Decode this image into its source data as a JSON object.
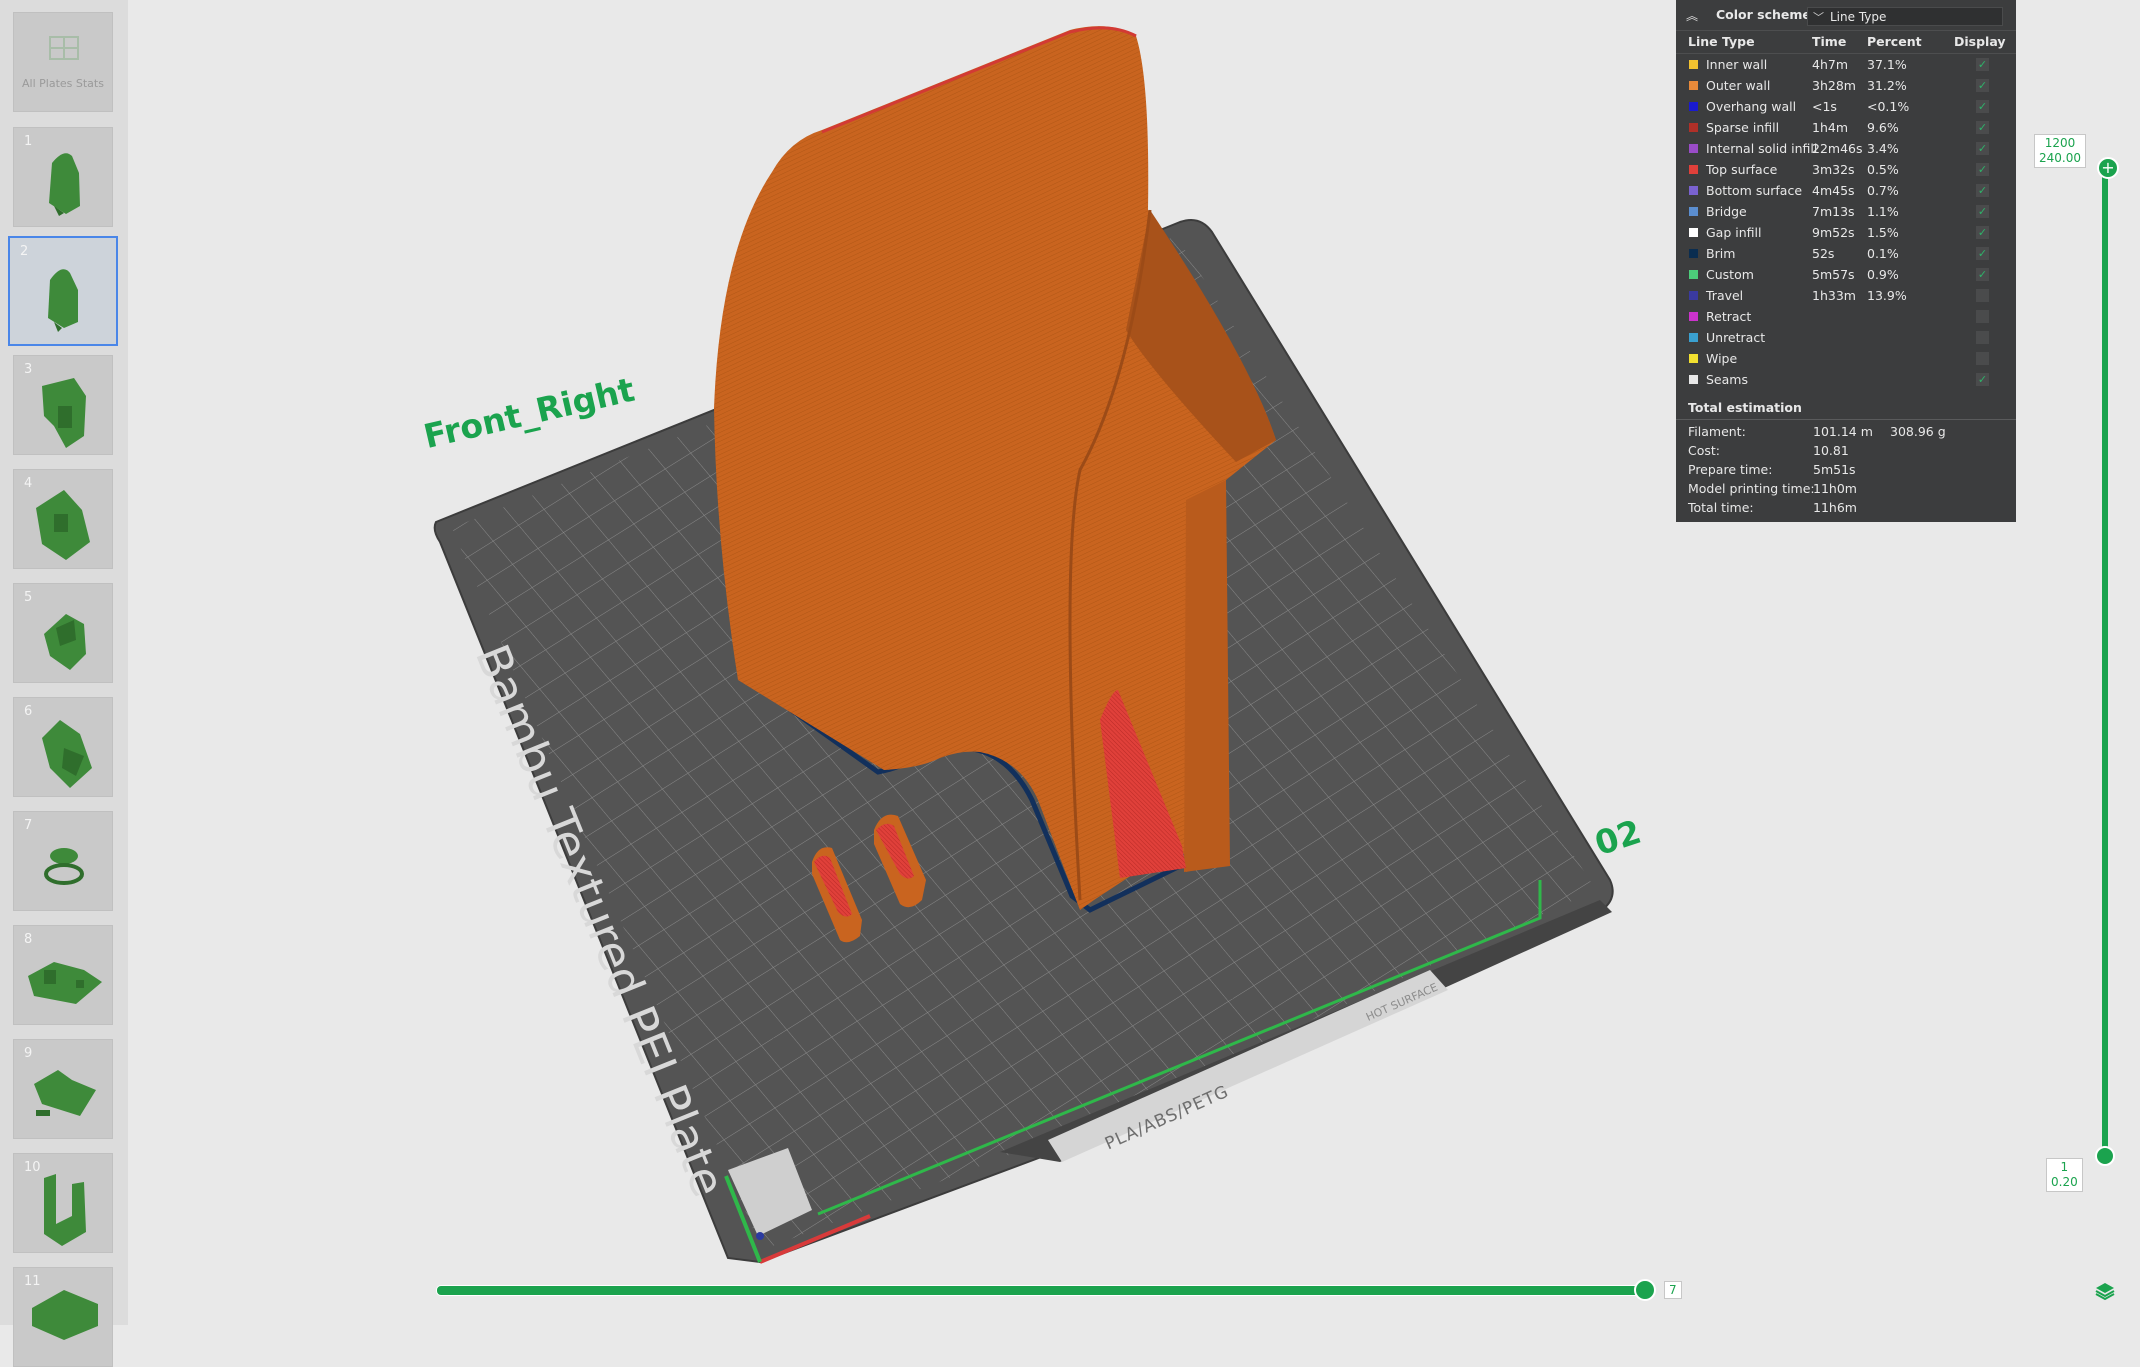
{
  "plates": {
    "all_label": "All Plates Stats",
    "items": [
      {
        "num": "1"
      },
      {
        "num": "2"
      },
      {
        "num": "3"
      },
      {
        "num": "4"
      },
      {
        "num": "5"
      },
      {
        "num": "6"
      },
      {
        "num": "7"
      },
      {
        "num": "8"
      },
      {
        "num": "9"
      },
      {
        "num": "10"
      },
      {
        "num": "11"
      }
    ],
    "selected": "2"
  },
  "scene": {
    "view_label": "Front_Right",
    "plate_name": "Bambu Textured PEI Plate",
    "plate_number": "02",
    "plate_material": "PLA/ABS/PETG",
    "hot_surface": "HOT SURFACE"
  },
  "legend": {
    "title": "Color scheme",
    "scheme": "Line Type",
    "headers": {
      "type": "Line Type",
      "time": "Time",
      "percent": "Percent",
      "display": "Display"
    },
    "rows": [
      {
        "label": "Inner wall",
        "time": "4h7m",
        "percent": "37.1%",
        "color": "#f2c230",
        "checked": true
      },
      {
        "label": "Outer wall",
        "time": "3h28m",
        "percent": "31.2%",
        "color": "#e88a3a",
        "checked": true
      },
      {
        "label": "Overhang wall",
        "time": "<1s",
        "percent": "<0.1%",
        "color": "#1a1ad0",
        "checked": true
      },
      {
        "label": "Sparse infill",
        "time": "1h4m",
        "percent": "9.6%",
        "color": "#b03028",
        "checked": true
      },
      {
        "label": "Internal solid infill",
        "time": "22m46s",
        "percent": "3.4%",
        "color": "#9a4cc8",
        "checked": true
      },
      {
        "label": "Top surface",
        "time": "3m32s",
        "percent": "0.5%",
        "color": "#e0403a",
        "checked": true
      },
      {
        "label": "Bottom surface",
        "time": "4m45s",
        "percent": "0.7%",
        "color": "#7a62d0",
        "checked": true
      },
      {
        "label": "Bridge",
        "time": "7m13s",
        "percent": "1.1%",
        "color": "#5b8ed0",
        "checked": true
      },
      {
        "label": "Gap infill",
        "time": "9m52s",
        "percent": "1.5%",
        "color": "#ffffff",
        "checked": true
      },
      {
        "label": "Brim",
        "time": "52s",
        "percent": "0.1%",
        "color": "#0a2d50",
        "checked": true
      },
      {
        "label": "Custom",
        "time": "5m57s",
        "percent": "0.9%",
        "color": "#4ccc7a",
        "checked": true
      },
      {
        "label": "Travel",
        "time": "1h33m",
        "percent": "13.9%",
        "color": "#3a3aa0",
        "checked": false
      },
      {
        "label": "Retract",
        "time": "",
        "percent": "",
        "color": "#cc33cc",
        "checked": false
      },
      {
        "label": "Unretract",
        "time": "",
        "percent": "",
        "color": "#3aa0d0",
        "checked": false
      },
      {
        "label": "Wipe",
        "time": "",
        "percent": "",
        "color": "#f2e030",
        "checked": false
      },
      {
        "label": "Seams",
        "time": "",
        "percent": "",
        "color": "#e8e8e8",
        "checked": true
      }
    ],
    "estimation_title": "Total estimation",
    "estimation": {
      "filament_label": "Filament:",
      "filament_len": "101.14 m",
      "filament_weight": "308.96 g",
      "cost_label": "Cost:",
      "cost": "10.81",
      "prepare_label": "Prepare time:",
      "prepare": "5m51s",
      "model_label": "Model printing time:",
      "model": "11h0m",
      "total_label": "Total time:",
      "total": "11h6m"
    }
  },
  "layer_slider": {
    "top_layer": "1200",
    "top_height": "240.00",
    "bottom_layer": "1",
    "bottom_height": "0.20"
  },
  "move_slider": {
    "value": "7"
  },
  "colors": {
    "accent": "#1ba34e",
    "model": "#c9641f",
    "plate": "#5a5a5a"
  }
}
